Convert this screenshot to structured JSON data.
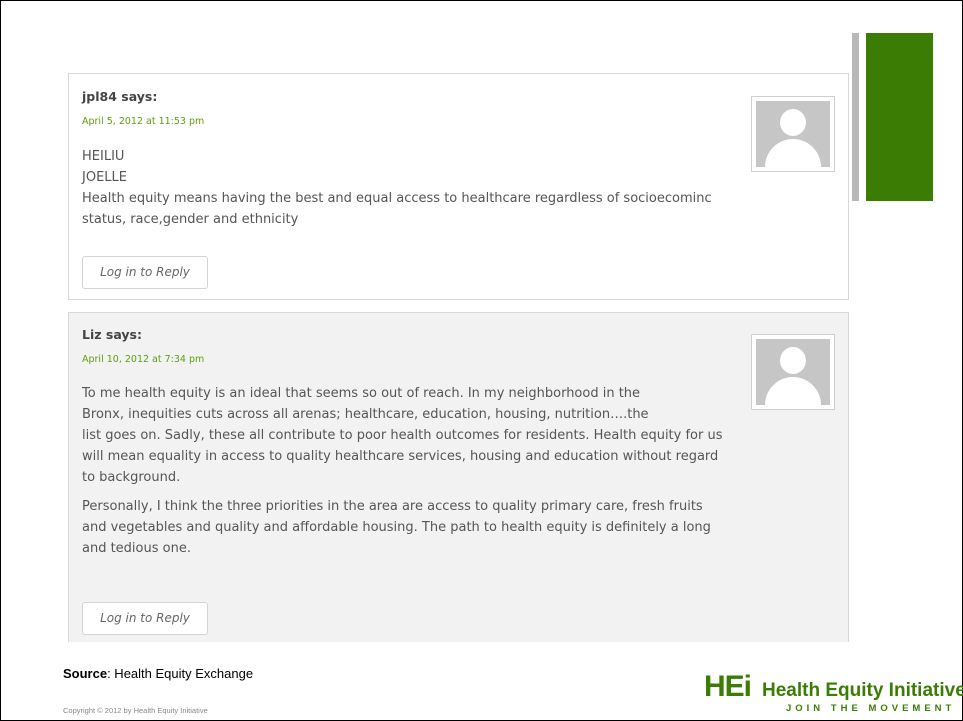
{
  "comments": [
    {
      "author": "jpl84",
      "says": "says:",
      "date": "April 5, 2012 at 11:53 pm",
      "lines": [
        "HEILIU",
        "JOELLE",
        "Health equity means having the best and equal access to healthcare regardless of socioecominc",
        "status, race,gender and ethnicity"
      ],
      "reply_label": "Log in to Reply"
    },
    {
      "author": "Liz",
      "says": "says:",
      "date": "April 10, 2012 at 7:34 pm",
      "lines": [
        "To me health equity is an ideal that seems so out of reach. In my neighborhood in the",
        "Bronx, inequities cuts across all arenas; healthcare, education, housing, nutrition….the",
        "list goes on. Sadly, these all contribute to poor health outcomes for residents. Health equity for us",
        "will mean equality in access to quality healthcare services, housing and education without regard",
        "to background.",
        "Personally, I think the three priorities in the area are access to quality primary care, fresh fruits",
        "and vegetables and quality and affordable housing. The path to health equity is definitely a long",
        "and tedious one."
      ],
      "reply_label": "Log in to Reply"
    }
  ],
  "footer": {
    "source_label": "Source",
    "source_text": ": Health Equity Exchange",
    "copyright": "Copyright © 2012 by Health Equity Initiative"
  },
  "logo": {
    "mark": "HEi",
    "name": "Health Equity Initiative",
    "tagline": "JOIN THE MOVEMENT"
  },
  "colors": {
    "accent_green": "#3b7d04",
    "date_green": "#5e9e10"
  }
}
